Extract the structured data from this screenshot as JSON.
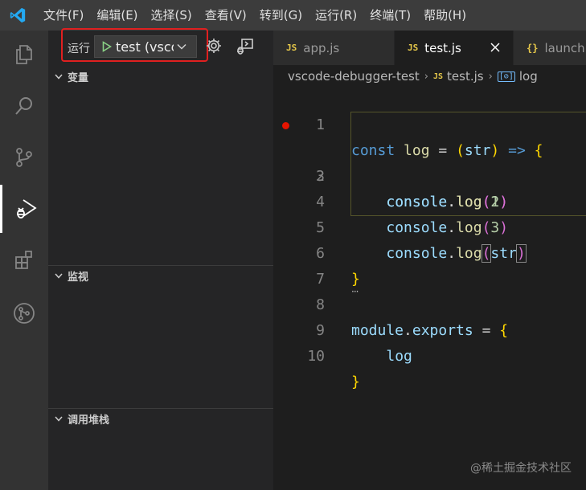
{
  "menu": [
    "文件(F)",
    "编辑(E)",
    "选择(S)",
    "查看(V)",
    "转到(G)",
    "运行(R)",
    "终端(T)",
    "帮助(H)"
  ],
  "activity_bar": [
    "explorer-icon",
    "search-icon",
    "source-control-icon",
    "run-debug-icon",
    "extensions-icon",
    "git-graph-icon"
  ],
  "sidebar": {
    "run_label": "运行",
    "config_value": "test (vsco",
    "sections": {
      "variables": "变量",
      "watch": "监视",
      "call_stack": "调用堆栈"
    }
  },
  "tabs": [
    {
      "icon": "JS",
      "label": "app.js"
    },
    {
      "icon": "JS",
      "label": "test.js",
      "active": true
    },
    {
      "icon": "{}",
      "label": "launch."
    }
  ],
  "breadcrumb": {
    "folder": "vscode-debugger-test",
    "file_icon": "JS",
    "file": "test.js",
    "symbol_icon": "[⊘]",
    "symbol": "log"
  },
  "editor": {
    "line_numbers": [
      "1",
      "2",
      "3",
      "4",
      "5",
      "6",
      "7",
      "8",
      "9",
      "10"
    ],
    "breakpoint_line": 2,
    "code": [
      "const log = (str) => {",
      "    console.log(1)",
      "    console.log(2)",
      "    console.log(3)",
      "    console.log(str)",
      "}",
      "",
      "module.exports = {",
      "    log",
      "}"
    ],
    "fold_marker": "···"
  },
  "watermark": "@稀土掘金技术社区",
  "colors": {
    "highlight_box": "#e02020",
    "breakpoint": "#e51400",
    "keyword": "#569cd6",
    "variable": "#9cdcfe",
    "function": "#dcdcaa",
    "number": "#b5cea8",
    "bracket_level1": "#ffd700",
    "bracket_level2": "#da70d6"
  }
}
